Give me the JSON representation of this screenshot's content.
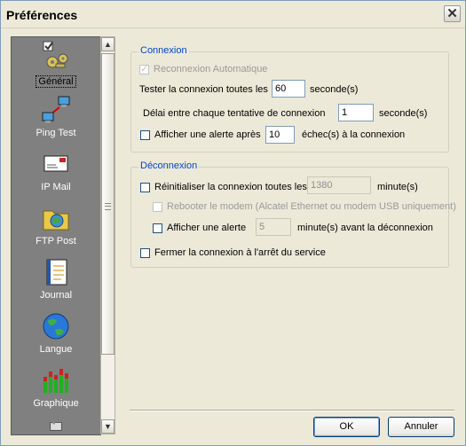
{
  "window": {
    "title": "Préférences"
  },
  "sidebar": {
    "items": [
      {
        "label": "Général",
        "icon": "general-settings-icon",
        "selected": true
      },
      {
        "label": "Ping Test",
        "icon": "ping-test-network-icon"
      },
      {
        "label": "IP Mail",
        "icon": "ip-mail-envelope-icon"
      },
      {
        "label": "FTP Post",
        "icon": "ftp-post-folder-icon"
      },
      {
        "label": "Journal",
        "icon": "journal-notebook-icon"
      },
      {
        "label": "Langue",
        "icon": "language-globe-icon"
      },
      {
        "label": "Graphique",
        "icon": "graph-bars-icon"
      }
    ]
  },
  "connexion": {
    "legend": "Connexion",
    "auto_reconnect_label": "Reconnexion Automatique",
    "test_label": "Tester la connexion toutes les",
    "test_value": "60",
    "test_unit": "seconde(s)",
    "delay_label": "Délai entre chaque tentative de connexion",
    "delay_value": "1",
    "delay_unit": "seconde(s)",
    "alert_label": "Afficher une alerte après",
    "alert_value": "10",
    "alert_unit": "échec(s) à la connexion"
  },
  "deconnexion": {
    "legend": "Déconnexion",
    "reset_label": "Réinitialiser la connexion toutes les",
    "reset_value": "1380",
    "reset_unit": "minute(s)",
    "reboot_label": "Rebooter le modem (Alcatel Ethernet ou modem USB uniquement)",
    "alert_label": "Afficher une alerte",
    "alert_value": "5",
    "alert_unit": "minute(s) avant la déconnexion",
    "close_label": "Fermer la connexion à l'arrêt du service"
  },
  "buttons": {
    "ok": "OK",
    "cancel": "Annuler"
  },
  "colors": {
    "legend": "#0046d5",
    "sidebar_bg": "#808080",
    "window_bg": "#ece9d8"
  }
}
